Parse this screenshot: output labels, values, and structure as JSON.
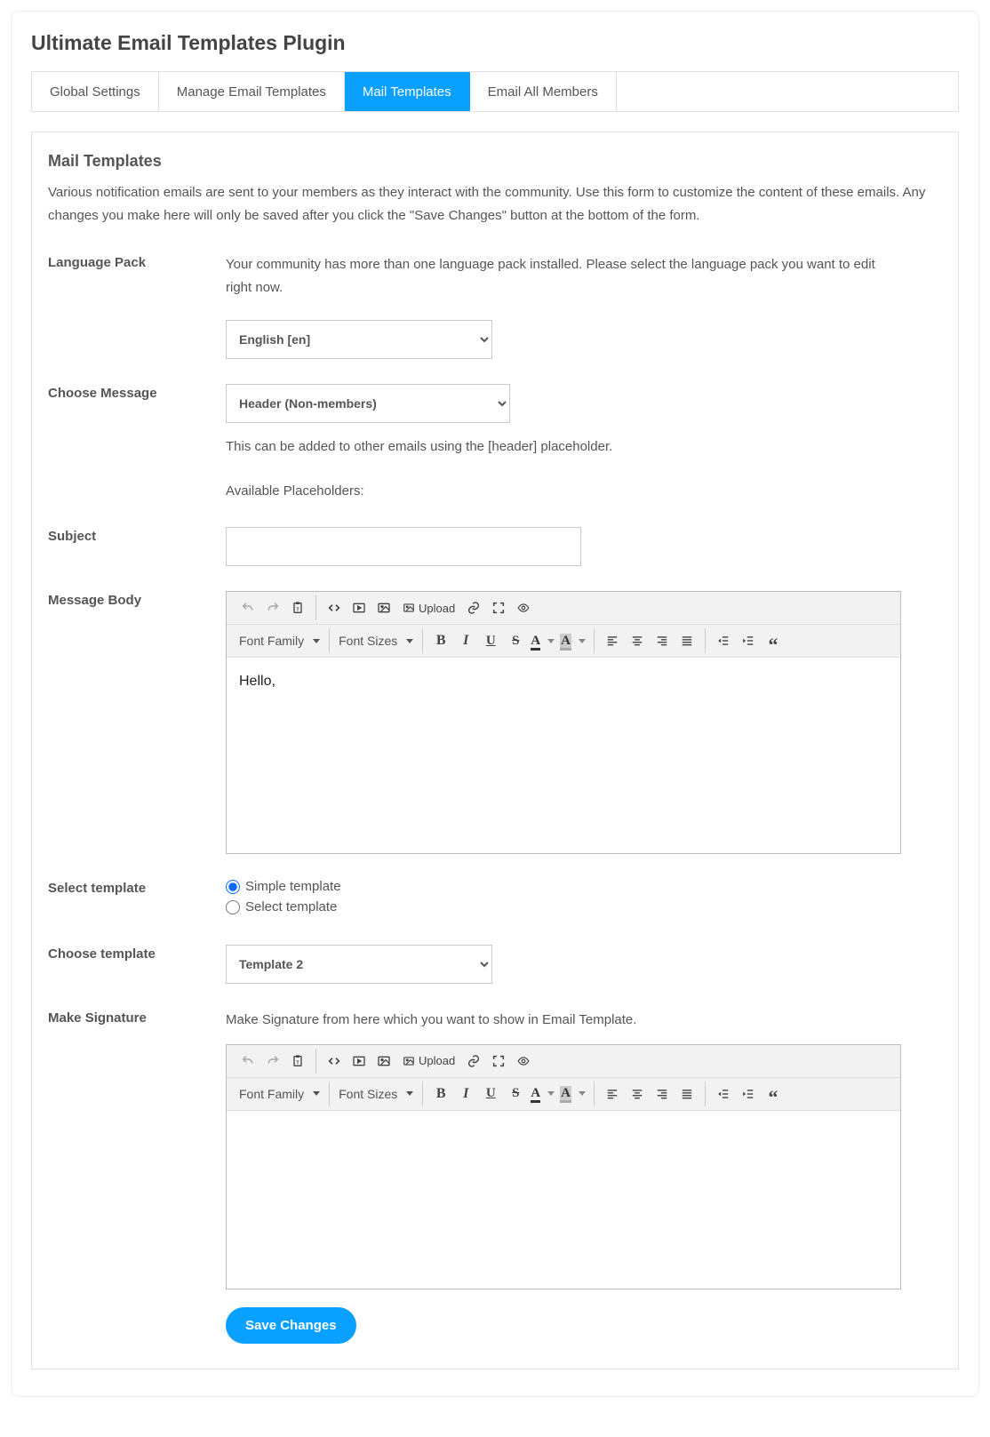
{
  "page": {
    "title": "Ultimate Email Templates Plugin"
  },
  "tabs": [
    {
      "label": "Global Settings",
      "active": false
    },
    {
      "label": "Manage Email Templates",
      "active": false
    },
    {
      "label": "Mail Templates",
      "active": true
    },
    {
      "label": "Email All Members",
      "active": false
    }
  ],
  "section": {
    "title": "Mail Templates",
    "description": "Various notification emails are sent to your members as they interact with the community. Use this form to customize the content of these emails. Any changes you make here will only be saved after you click the \"Save Changes\" button at the bottom of the form."
  },
  "form": {
    "language_pack": {
      "label": "Language Pack",
      "help": "Your community has more than one language pack installed. Please select the language pack you want to edit right now.",
      "selected": "English [en]",
      "options": [
        "English [en]"
      ]
    },
    "choose_message": {
      "label": "Choose Message",
      "selected": "Header (Non-members)",
      "options": [
        "Header (Non-members)"
      ],
      "help1": "This can be added to other emails using the [header] placeholder.",
      "help2": "Available Placeholders:"
    },
    "subject": {
      "label": "Subject",
      "value": ""
    },
    "message_body": {
      "label": "Message Body",
      "content": "Hello,"
    },
    "select_template": {
      "label": "Select template",
      "options": [
        {
          "label": "Simple template",
          "checked": true
        },
        {
          "label": "Select template",
          "checked": false
        }
      ]
    },
    "choose_template": {
      "label": "Choose template",
      "selected": "Template 2",
      "options": [
        "Template 2"
      ]
    },
    "make_signature": {
      "label": "Make Signature",
      "help": "Make Signature from here which you want to show in Email Template.",
      "content": ""
    },
    "save_button": "Save Changes"
  },
  "toolbar": {
    "font_family": "Font Family",
    "font_sizes": "Font Sizes",
    "upload": "Upload"
  }
}
